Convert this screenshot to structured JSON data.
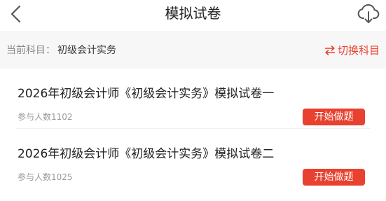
{
  "header": {
    "title": "模拟试卷",
    "back_icon": "chevron-left-icon",
    "download_icon": "cloud-download-icon"
  },
  "subject_bar": {
    "label": "当前科目：",
    "value": "初级会计实务",
    "switch_label": "切换科目",
    "switch_icon": "swap-arrows-icon"
  },
  "papers": [
    {
      "title": "2026年初级会计师《初级会计实务》模拟试卷一",
      "participants": "参与人数1102",
      "button_label": "开始做题"
    },
    {
      "title": "2026年初级会计师《初级会计实务》模拟试卷二",
      "participants": "参与人数1025",
      "button_label": "开始做题"
    }
  ],
  "colors": {
    "accent": "#e8412f",
    "subject_bar_bg": "#f7f7f7",
    "text_primary": "#222222",
    "text_secondary": "#999999"
  }
}
